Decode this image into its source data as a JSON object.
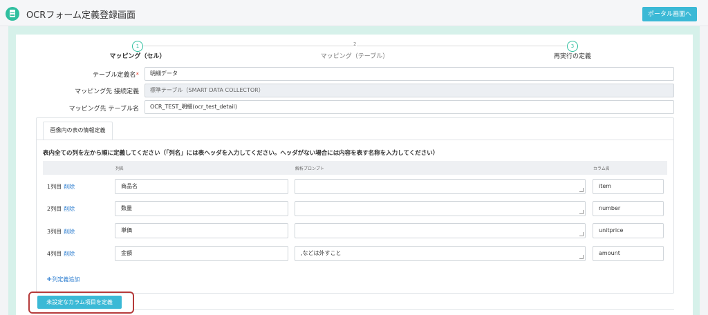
{
  "header": {
    "title": "OCRフォーム定義登録画面",
    "portal_button": "ポータル画面へ"
  },
  "steps": [
    {
      "number": "1",
      "label": "マッピング（セル）"
    },
    {
      "number": "2",
      "label": "マッピング（テーブル）"
    },
    {
      "number": "3",
      "label": "再実行の定義"
    }
  ],
  "form": {
    "table_name_label": "テーブル定義名",
    "table_name_required": "*",
    "table_name_value": "明細データ",
    "conn_label": "マッピング先 接続定義",
    "conn_value": "標準テーブル（SMART DATA COLLECTOR）",
    "dest_table_label": "マッピング先 テーブル名",
    "dest_table_value": "OCR_TEST_明細(ocr_test_detail)"
  },
  "panel": {
    "tab_label": "画像内の表の情報定義",
    "instruction": "表内全ての列を左から順に定義してください（「列名」には表ヘッダを入力してください。ヘッダがない場合には内容を表す名称を入力してください）",
    "columns_header": {
      "col_name": "列名",
      "prompt": "解析プロンプト",
      "column_name": "カラム名"
    },
    "rows": [
      {
        "label": "1列目",
        "delete": "削除",
        "col_name": "商品名",
        "prompt": "",
        "column": "item"
      },
      {
        "label": "2列目",
        "delete": "削除",
        "col_name": "数量",
        "prompt": "",
        "column": "number"
      },
      {
        "label": "3列目",
        "delete": "削除",
        "col_name": "単価",
        "prompt": "",
        "column": "unitprice"
      },
      {
        "label": "4列目",
        "delete": "削除",
        "col_name": "金額",
        "prompt": ",などは外すこと",
        "column": "amount"
      }
    ],
    "add_column": "列定義追加",
    "add_symbol": "+"
  },
  "define_button": "未設定なカラム項目を定義",
  "colors": {
    "accent": "#3bb9d6",
    "brand_green": "#2fbf9f",
    "highlight": "#b53a3a"
  }
}
